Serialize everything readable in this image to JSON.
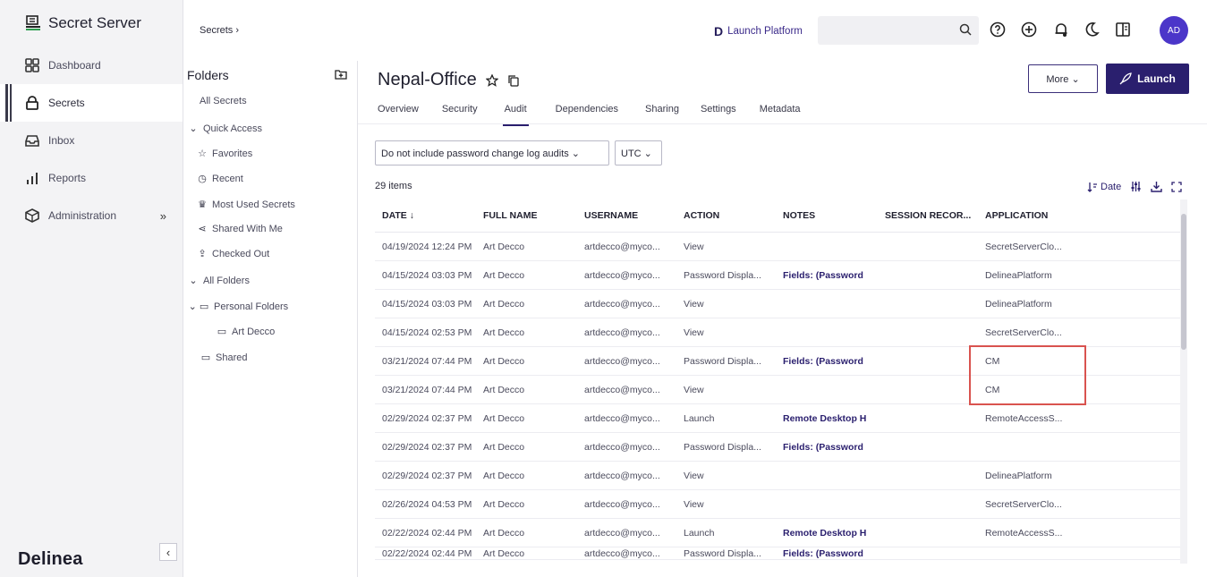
{
  "brand": {
    "app_name": "Secret Server",
    "logo_text": "Delinea",
    "accent": "#2a1f6e",
    "avatar_color": "#4b36c9"
  },
  "nav": {
    "items": [
      {
        "label": "Dashboard",
        "icon": "dashboard-icon"
      },
      {
        "label": "Secrets",
        "icon": "lock-icon",
        "active": true
      },
      {
        "label": "Inbox",
        "icon": "inbox-icon"
      },
      {
        "label": "Reports",
        "icon": "bar-chart-icon"
      },
      {
        "label": "Administration",
        "icon": "cube-icon",
        "expand": "»"
      }
    ],
    "collapse_glyph": "‹"
  },
  "topbar": {
    "breadcrumb": "Secrets ›",
    "launch_platform": "Launch Platform",
    "search_placeholder": "",
    "avatar": "AD"
  },
  "folders": {
    "title": "Folders",
    "items": [
      {
        "label": "All Secrets",
        "icon": ""
      },
      {
        "label": "Quick Access",
        "icon": "⌄"
      },
      {
        "label": "Favorites",
        "icon": "☆"
      },
      {
        "label": "Recent",
        "icon": "◷"
      },
      {
        "label": "Most Used Secrets",
        "icon": "♛"
      },
      {
        "label": "Shared With Me",
        "icon": "⋖"
      },
      {
        "label": "Checked Out",
        "icon": "⇪"
      },
      {
        "label": "All Folders",
        "icon": "⌄"
      },
      {
        "label": "Personal Folders",
        "icon": "⌄ ▭"
      },
      {
        "label": "Art Decco",
        "icon": "▭"
      },
      {
        "label": "Shared",
        "icon": "▭"
      }
    ]
  },
  "secret": {
    "title": "Nepal-Office",
    "more_label": "More ⌄",
    "launch_label": "Launch",
    "tabs": [
      "Overview",
      "Security",
      "Audit",
      "Dependencies",
      "Sharing",
      "Settings",
      "Metadata"
    ],
    "active_tab": "Audit"
  },
  "filters": {
    "audit_filter": "Do not include password change log audits ⌄",
    "timezone": "UTC ⌄"
  },
  "items_count": "29 items",
  "sort_label": "Date",
  "table": {
    "columns": [
      "DATE ↓",
      "FULL NAME",
      "USERNAME",
      "ACTION",
      "NOTES",
      "SESSION RECOR...",
      "APPLICATION"
    ],
    "rows": [
      [
        "04/19/2024 12:24 PM",
        "Art Decco",
        "artdecco@myco...",
        "View",
        "",
        "",
        "SecretServerClo..."
      ],
      [
        "04/15/2024 03:03 PM",
        "Art Decco",
        "artdecco@myco...",
        "Password Displa...",
        "Fields: (Password",
        "",
        "DelineaPlatform"
      ],
      [
        "04/15/2024 03:03 PM",
        "Art Decco",
        "artdecco@myco...",
        "View",
        "",
        "",
        "DelineaPlatform"
      ],
      [
        "04/15/2024 02:53 PM",
        "Art Decco",
        "artdecco@myco...",
        "View",
        "",
        "",
        "SecretServerClo..."
      ],
      [
        "03/21/2024 07:44 PM",
        "Art Decco",
        "artdecco@myco...",
        "Password Displa...",
        "Fields: (Password",
        "",
        "CM"
      ],
      [
        "03/21/2024 07:44 PM",
        "Art Decco",
        "artdecco@myco...",
        "View",
        "",
        "",
        "CM"
      ],
      [
        "02/29/2024 02:37 PM",
        "Art Decco",
        "artdecco@myco...",
        "Launch",
        "Remote Desktop H",
        "",
        "RemoteAccessS..."
      ],
      [
        "02/29/2024 02:37 PM",
        "Art Decco",
        "artdecco@myco...",
        "Password Displa...",
        "Fields: (Password",
        "",
        ""
      ],
      [
        "02/29/2024 02:37 PM",
        "Art Decco",
        "artdecco@myco...",
        "View",
        "",
        "",
        "DelineaPlatform"
      ],
      [
        "02/26/2024 04:53 PM",
        "Art Decco",
        "artdecco@myco...",
        "View",
        "",
        "",
        "SecretServerClo..."
      ],
      [
        "02/22/2024 02:44 PM",
        "Art Decco",
        "artdecco@myco...",
        "Launch",
        "Remote Desktop H",
        "",
        "RemoteAccessS..."
      ],
      [
        "02/22/2024 02:44 PM",
        "Art Decco",
        "artdecco@myco...",
        "Password Displa...",
        "Fields: (Password",
        "",
        ""
      ]
    ]
  }
}
